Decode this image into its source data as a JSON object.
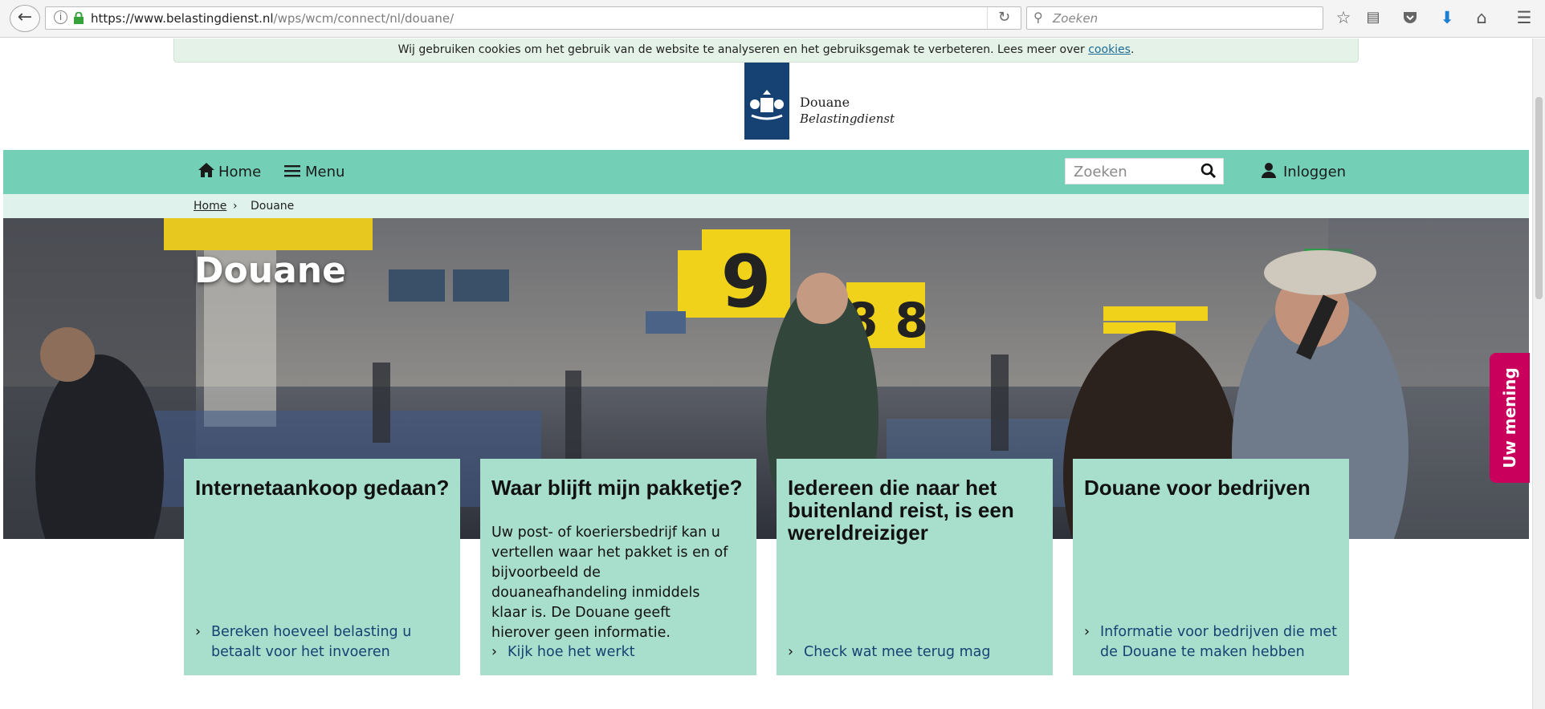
{
  "browser": {
    "url_host": "https://www.belastingdienst.nl",
    "url_path": "/wps/wcm/connect/nl/douane/",
    "search_placeholder": "Zoeken"
  },
  "cookie_bar": {
    "text": "Wij gebruiken cookies om het gebruik van de website te analyseren en het gebruiksgemak te verbeteren. Lees meer over ",
    "link": "cookies",
    "end": "."
  },
  "logo": {
    "line1": "Douane",
    "line2": "Belastingdienst"
  },
  "nav": {
    "home": "Home",
    "menu": "Menu",
    "search_placeholder": "Zoeken",
    "login": "Inloggen"
  },
  "breadcrumb": {
    "home": "Home",
    "separator": "›",
    "current": "Douane"
  },
  "hero": {
    "title": "Douane",
    "feedback": "Uw mening"
  },
  "cards": [
    {
      "title": "Internetaankoop gedaan?",
      "text": "",
      "link": "Bereken hoeveel belasting u betaalt voor het invoeren"
    },
    {
      "title": "Waar blijft mijn pakketje?",
      "text": "Uw post- of koeriersbedrijf kan u vertellen waar het pakket is en of bijvoorbeeld de douaneafhandeling inmiddels klaar is. De Douane geeft hierover geen informatie.",
      "link": "Kijk hoe het werkt"
    },
    {
      "title": "Iedereen die naar het buitenland reist, is een wereldreiziger",
      "text": "",
      "link": "Check wat mee terug mag"
    },
    {
      "title": "Douane voor bedrijven",
      "text": "",
      "link": "Informatie voor bedrijven die met de Douane te maken hebben"
    }
  ],
  "colors": {
    "nav": "#73d0b6",
    "breadcrumb_bg": "#dff3ec",
    "card": "#a8dfcc",
    "logo": "#154273",
    "feedback": "#ca005d",
    "link": "#154273"
  }
}
